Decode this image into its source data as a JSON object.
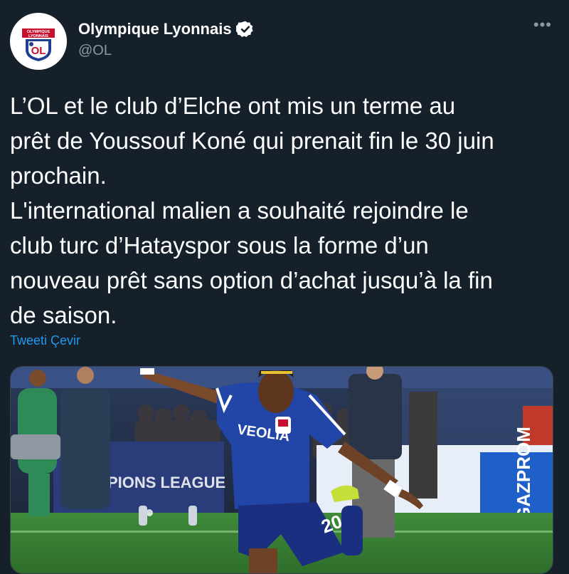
{
  "tweet": {
    "author": {
      "display_name": "Olympique Lyonnais",
      "handle": "@OL",
      "verified": true,
      "avatar_badge_text": "OLYMPIQUE LYONNAIS",
      "avatar_badge_letters": "OL"
    },
    "more_icon": "more-horizontal-icon",
    "text": "L’OL et le club d’Elche ont mis un terme au\nprêt de Youssouf Koné qui prenait fin le 30 juin\nprochain.\nL'international malien a souhaité rejoindre le\nclub turc d’Hatayspor sous la forme d’un\nnouveau prêt sans option d’achat jusqu’à la fin\nde saison.",
    "translate_label": "Tweeti Çevir",
    "media": {
      "jersey_text": "VEOLIA",
      "jersey_number": "20",
      "board_text_1": "CHAMPIONS LEAGUE",
      "board_text_2": "GAZPROM"
    }
  },
  "colors": {
    "background": "#15202b",
    "text": "#ffffff",
    "secondary": "#8b98a5",
    "link": "#1d9bf0",
    "verified": "#ffffff"
  }
}
